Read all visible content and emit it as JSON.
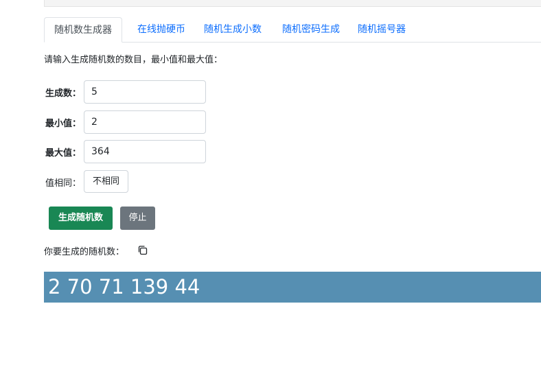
{
  "tabs": [
    {
      "label": "随机数生成器",
      "active": true
    },
    {
      "label": "在线抛硬币",
      "active": false
    },
    {
      "label": "随机生成小数",
      "active": false
    },
    {
      "label": "随机密码生成",
      "active": false
    },
    {
      "label": "随机摇号器",
      "active": false
    }
  ],
  "intro_text": "请输入生成随机数的数目，最小值和最大值：",
  "form": {
    "count_label": "生成数：",
    "count_value": "5",
    "min_label": "最小值：",
    "min_value": "2",
    "max_label": "最大值：",
    "max_value": "364",
    "unique_label": "值相同：",
    "unique_value": "不相同"
  },
  "buttons": {
    "generate_label": "生成随机数",
    "stop_label": "停止"
  },
  "result": {
    "label": "你要生成的随机数：",
    "value": "2 70 71 139 44",
    "copy_icon": "copy-icon"
  },
  "colors": {
    "primary_link": "#0d6efd",
    "success": "#198754",
    "secondary": "#6c757d",
    "result_bg": "#568fb2"
  }
}
